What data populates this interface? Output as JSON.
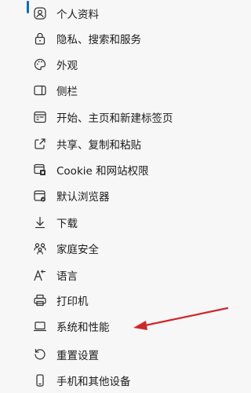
{
  "menu": {
    "items": [
      {
        "label": "个人资料",
        "icon": "profile-icon"
      },
      {
        "label": "隐私、搜索和服务",
        "icon": "lock-icon"
      },
      {
        "label": "外观",
        "icon": "palette-icon"
      },
      {
        "label": "侧栏",
        "icon": "sidebar-icon"
      },
      {
        "label": "开始、主页和新建标签页",
        "icon": "home-tabs-icon"
      },
      {
        "label": "共享、复制和粘贴",
        "icon": "share-icon"
      },
      {
        "label": "Cookie 和网站权限",
        "icon": "site-permissions-icon"
      },
      {
        "label": "默认浏览器",
        "icon": "default-browser-icon"
      },
      {
        "label": "下载",
        "icon": "download-icon"
      },
      {
        "label": "家庭安全",
        "icon": "family-icon"
      },
      {
        "label": "语言",
        "icon": "language-icon"
      },
      {
        "label": "打印机",
        "icon": "printer-icon"
      },
      {
        "label": "系统和性能",
        "icon": "laptop-icon"
      },
      {
        "label": "重置设置",
        "icon": "reset-icon"
      },
      {
        "label": "手机和其他设备",
        "icon": "phone-icon"
      }
    ]
  },
  "colors": {
    "accent": "#0f6cbd",
    "annotation_arrow": "#d0282a",
    "text": "#1b1b1b",
    "background": "#f7f7f7"
  }
}
